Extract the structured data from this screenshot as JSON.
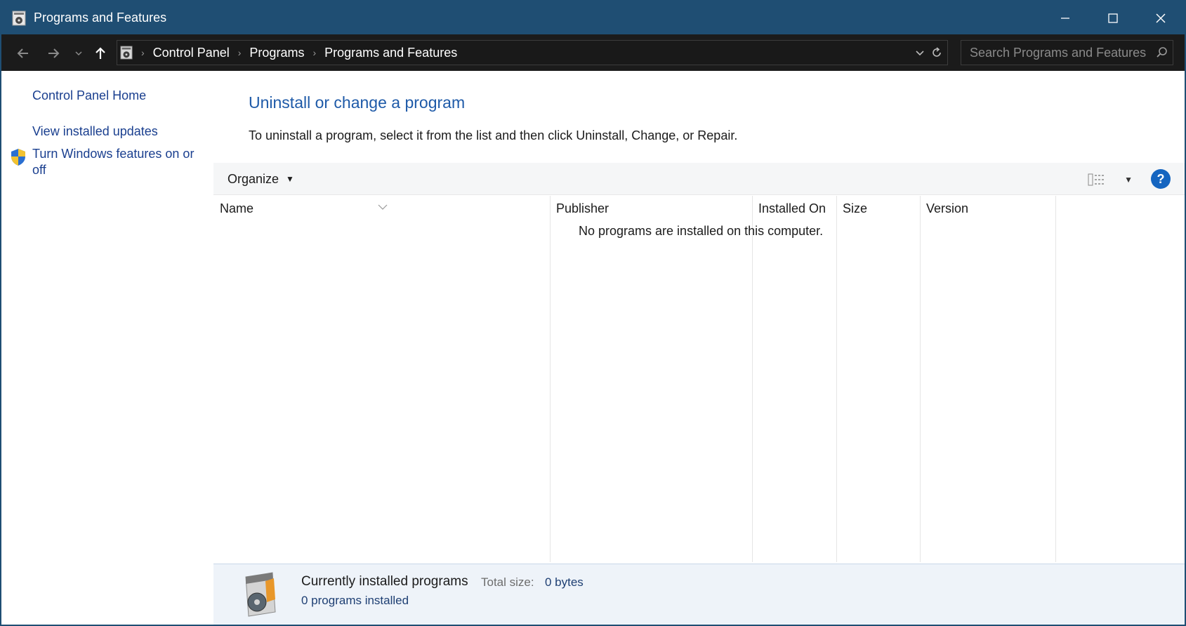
{
  "window": {
    "title": "Programs and Features",
    "accent_color": "#1f4e73",
    "icon": "programs-features-icon"
  },
  "address": {
    "breadcrumbs": [
      "Control Panel",
      "Programs",
      "Programs and Features"
    ]
  },
  "search": {
    "placeholder": "Search Programs and Features"
  },
  "sidebar": {
    "items": [
      {
        "label": "Control Panel Home"
      },
      {
        "label": "View installed updates"
      },
      {
        "label": "Turn Windows features on or off",
        "icon": "uac-shield-icon"
      }
    ]
  },
  "main": {
    "heading": "Uninstall or change a program",
    "instruction": "To uninstall a program, select it from the list and then click Uninstall, Change, or Repair.",
    "organize_label": "Organize",
    "help_label": "?",
    "columns": [
      "Name",
      "Publisher",
      "Installed On",
      "Size",
      "Version"
    ],
    "empty_message": "No programs are installed on this computer."
  },
  "details": {
    "title": "Currently installed programs",
    "total_size_label": "Total size:",
    "total_size_value": "0 bytes",
    "count_text": "0 programs installed"
  }
}
